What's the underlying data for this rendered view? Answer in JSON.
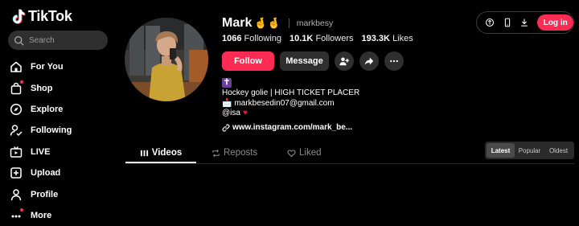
{
  "app": {
    "name": "TikTok"
  },
  "search": {
    "placeholder": "Search"
  },
  "nav": [
    {
      "label": "For You",
      "icon": "home-icon"
    },
    {
      "label": "Shop",
      "icon": "shopping-bag-icon"
    },
    {
      "label": "Explore",
      "icon": "compass-icon"
    },
    {
      "label": "Following",
      "icon": "user-following-icon"
    },
    {
      "label": "LIVE",
      "icon": "live-tv-icon"
    },
    {
      "label": "Upload",
      "icon": "upload-plus-icon"
    },
    {
      "label": "Profile",
      "icon": "person-icon"
    },
    {
      "label": "More",
      "icon": "more-icon"
    }
  ],
  "topbar": {
    "login_label": "Log in"
  },
  "profile": {
    "name": "Mark",
    "name_emoji": "🤞🤞",
    "handle": "markbesy",
    "stats": [
      {
        "value": "1066",
        "label": "Following"
      },
      {
        "value": "10.1K",
        "label": "Followers"
      },
      {
        "value": "193.3K",
        "label": "Likes"
      }
    ],
    "follow_label": "Follow",
    "message_label": "Message",
    "bio": {
      "cross": "✝",
      "line1": "Hockey golie | HIGH TICKET PLACER",
      "email_icon": "📩",
      "email": "markbesedin07@gmail.com",
      "line3": "@isa",
      "heart": "♥"
    },
    "link": "www.instagram.com/mark_be..."
  },
  "tabs": [
    {
      "label": "Videos"
    },
    {
      "label": "Reposts"
    },
    {
      "label": "Liked"
    }
  ],
  "sort": [
    {
      "label": "Latest"
    },
    {
      "label": "Popular"
    },
    {
      "label": "Oldest"
    }
  ],
  "colors": {
    "accent": "#fe2c55",
    "background": "#000000",
    "button_dark": "#2f2f2f"
  }
}
